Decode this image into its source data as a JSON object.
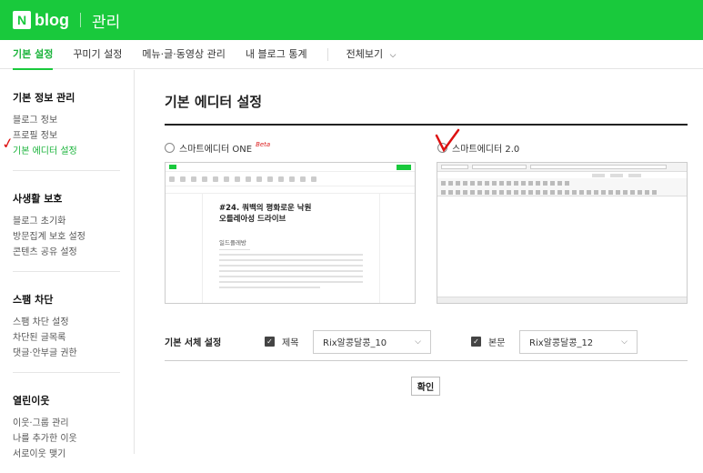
{
  "header": {
    "logo_n": "N",
    "logo_blog": "blog",
    "title": "관리"
  },
  "tabs": [
    {
      "label": "기본 설정",
      "active": true
    },
    {
      "label": "꾸미기 설정",
      "active": false
    },
    {
      "label": "메뉴·글·동영상 관리",
      "active": false
    },
    {
      "label": "내 블로그 통계",
      "active": false
    },
    {
      "label": "전체보기",
      "active": false
    }
  ],
  "tabs_more_icon": "chevron-down-icon",
  "sidebar": {
    "groups": [
      {
        "title": "기본 정보 관리",
        "items": [
          "블로그 정보",
          "프로필 정보",
          "기본 에디터 설정"
        ],
        "active_index": 2
      },
      {
        "title": "사생활 보호",
        "items": [
          "블로그 초기화",
          "방문집계 보호 설정",
          "콘텐츠 공유 설정"
        ]
      },
      {
        "title": "스팸 차단",
        "items": [
          "스팸 차단 설정",
          "차단된 글목록",
          "댓글·안부글 권한"
        ]
      },
      {
        "title": "열린이웃",
        "items": [
          "이웃·그룹 관리",
          "나를 추가한 이웃",
          "서로이웃 맺기"
        ]
      }
    ],
    "annotation_mark": "✓"
  },
  "main": {
    "title": "기본 에디터 설정",
    "editor_options": [
      {
        "label": "스마트에디터 ONE",
        "badge": "Beta",
        "selected": false
      },
      {
        "label": "스마트에디터 2.0",
        "selected": false
      }
    ],
    "preview_one": {
      "heading_line1": "#24. 쿼백의 평화로운 낙원",
      "heading_line2": "오를레아성 드라이브",
      "subheading": "일드플레방"
    },
    "font_setting": {
      "label": "기본 서체 설정",
      "title_checkbox_label": "제목",
      "title_font": "Rix알콩달콩_10",
      "body_checkbox_label": "본문",
      "body_font": "Rix알콩달콩_12"
    },
    "confirm_label": "확인"
  },
  "colors": {
    "brand_green": "#19c93c",
    "annotation_red": "#d11"
  }
}
